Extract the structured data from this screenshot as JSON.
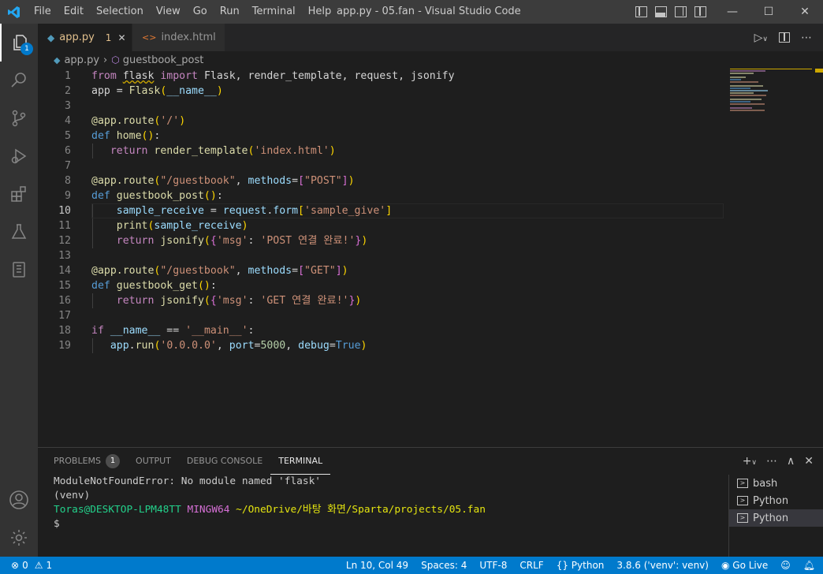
{
  "window": {
    "title": "app.py - 05.fan - Visual Studio Code",
    "menu": [
      "File",
      "Edit",
      "Selection",
      "View",
      "Go",
      "Run",
      "Terminal",
      "Help"
    ]
  },
  "activity_bar": {
    "explorer_badge": "1",
    "items": [
      "explorer-icon",
      "search-icon",
      "source-control-icon",
      "run-debug-icon",
      "extensions-icon",
      "testing-icon",
      "remote-explorer-icon",
      "account-icon",
      "settings-gear-icon"
    ]
  },
  "tabs": [
    {
      "label": "app.py",
      "problems": "1",
      "state": "active"
    },
    {
      "label": "index.html",
      "state": "modified"
    }
  ],
  "breadcrumb": {
    "file": "app.py",
    "symbol": "guestbook_post"
  },
  "editor": {
    "current_line": 10,
    "lines": [
      {
        "n": "1",
        "tokens": [
          [
            "kw2",
            "from "
          ],
          [
            "plain squig",
            "flask"
          ],
          [
            "kw2",
            " import "
          ],
          [
            "plain",
            "Flask, render_template, request, jsonify"
          ]
        ]
      },
      {
        "n": "2",
        "tokens": [
          [
            "plain",
            "app = "
          ],
          [
            "fn",
            "Flask"
          ],
          [
            "br1",
            "("
          ],
          [
            "var",
            "__name__"
          ],
          [
            "br1",
            ")"
          ]
        ]
      },
      {
        "n": "3",
        "tokens": []
      },
      {
        "n": "4",
        "tokens": [
          [
            "fn",
            "@app.route"
          ],
          [
            "br1",
            "("
          ],
          [
            "str",
            "'/'"
          ],
          [
            "br1",
            ")"
          ]
        ]
      },
      {
        "n": "5",
        "tokens": [
          [
            "kw",
            "def "
          ],
          [
            "fn",
            "home"
          ],
          [
            "br1",
            "()"
          ],
          [
            "plain",
            ":"
          ]
        ]
      },
      {
        "n": "6",
        "tokens": [
          [
            "plain",
            "   "
          ],
          [
            "kw2",
            "return "
          ],
          [
            "fn",
            "render_template"
          ],
          [
            "br1",
            "("
          ],
          [
            "str",
            "'index.html'"
          ],
          [
            "br1",
            ")"
          ]
        ]
      },
      {
        "n": "7",
        "tokens": []
      },
      {
        "n": "8",
        "tokens": [
          [
            "fn",
            "@app.route"
          ],
          [
            "br1",
            "("
          ],
          [
            "str",
            "\"/guestbook\""
          ],
          [
            "plain",
            ", "
          ],
          [
            "var",
            "methods"
          ],
          [
            "plain",
            "="
          ],
          [
            "br2",
            "["
          ],
          [
            "str",
            "\"POST\""
          ],
          [
            "br2",
            "]"
          ],
          [
            "br1",
            ")"
          ]
        ]
      },
      {
        "n": "9",
        "tokens": [
          [
            "kw",
            "def "
          ],
          [
            "fn",
            "guestbook_post"
          ],
          [
            "br1",
            "()"
          ],
          [
            "plain",
            ":"
          ]
        ]
      },
      {
        "n": "10",
        "tokens": [
          [
            "plain",
            "    "
          ],
          [
            "var",
            "sample_receive"
          ],
          [
            "plain",
            " = "
          ],
          [
            "var",
            "request"
          ],
          [
            "plain",
            "."
          ],
          [
            "var",
            "form"
          ],
          [
            "br1",
            "["
          ],
          [
            "str",
            "'sample_give'"
          ],
          [
            "br1",
            "]"
          ]
        ]
      },
      {
        "n": "11",
        "tokens": [
          [
            "plain",
            "    "
          ],
          [
            "fn",
            "print"
          ],
          [
            "br1",
            "("
          ],
          [
            "var",
            "sample_receive"
          ],
          [
            "br1",
            ")"
          ]
        ]
      },
      {
        "n": "12",
        "tokens": [
          [
            "plain",
            "    "
          ],
          [
            "kw2",
            "return "
          ],
          [
            "fn",
            "jsonify"
          ],
          [
            "br1",
            "("
          ],
          [
            "br2",
            "{"
          ],
          [
            "str",
            "'msg'"
          ],
          [
            "plain",
            ": "
          ],
          [
            "str",
            "'POST 연결 완료!'"
          ],
          [
            "br2",
            "}"
          ],
          [
            "br1",
            ")"
          ]
        ]
      },
      {
        "n": "13",
        "tokens": []
      },
      {
        "n": "14",
        "tokens": [
          [
            "fn",
            "@app.route"
          ],
          [
            "br1",
            "("
          ],
          [
            "str",
            "\"/guestbook\""
          ],
          [
            "plain",
            ", "
          ],
          [
            "var",
            "methods"
          ],
          [
            "plain",
            "="
          ],
          [
            "br2",
            "["
          ],
          [
            "str",
            "\"GET\""
          ],
          [
            "br2",
            "]"
          ],
          [
            "br1",
            ")"
          ]
        ]
      },
      {
        "n": "15",
        "tokens": [
          [
            "kw",
            "def "
          ],
          [
            "fn",
            "guestbook_get"
          ],
          [
            "br1",
            "()"
          ],
          [
            "plain",
            ":"
          ]
        ]
      },
      {
        "n": "16",
        "tokens": [
          [
            "plain",
            "    "
          ],
          [
            "kw2",
            "return "
          ],
          [
            "fn",
            "jsonify"
          ],
          [
            "br1",
            "("
          ],
          [
            "br2",
            "{"
          ],
          [
            "str",
            "'msg'"
          ],
          [
            "plain",
            ": "
          ],
          [
            "str",
            "'GET 연결 완료!'"
          ],
          [
            "br2",
            "}"
          ],
          [
            "br1",
            ")"
          ]
        ]
      },
      {
        "n": "17",
        "tokens": []
      },
      {
        "n": "18",
        "tokens": [
          [
            "kw2",
            "if "
          ],
          [
            "var",
            "__name__"
          ],
          [
            "plain",
            " == "
          ],
          [
            "str",
            "'__main__'"
          ],
          [
            "plain",
            ":"
          ]
        ]
      },
      {
        "n": "19",
        "tokens": [
          [
            "plain",
            "   "
          ],
          [
            "var",
            "app"
          ],
          [
            "plain",
            "."
          ],
          [
            "fn",
            "run"
          ],
          [
            "br1",
            "("
          ],
          [
            "str",
            "'0.0.0.0'"
          ],
          [
            "plain",
            ", "
          ],
          [
            "var",
            "port"
          ],
          [
            "plain",
            "="
          ],
          [
            "num",
            "5000"
          ],
          [
            "plain",
            ", "
          ],
          [
            "var",
            "debug"
          ],
          [
            "plain",
            "="
          ],
          [
            "kw",
            "True"
          ],
          [
            "br1",
            ")"
          ]
        ]
      }
    ]
  },
  "panel": {
    "tabs": [
      {
        "label": "PROBLEMS",
        "badge": "1"
      },
      {
        "label": "OUTPUT"
      },
      {
        "label": "DEBUG CONSOLE"
      },
      {
        "label": "TERMINAL",
        "active": true
      }
    ],
    "terminal_lines": [
      "ModuleNotFoundError: No module named 'flask'",
      "(venv)"
    ],
    "prompt": {
      "user": "Toras@DESKTOP-LPM48TT",
      "shell": "MINGW64",
      "path": "~/OneDrive/바탕 화면/Sparta/projects/05.fan",
      "symbol": "$"
    },
    "terminals": [
      {
        "label": "bash"
      },
      {
        "label": "Python"
      },
      {
        "label": "Python",
        "selected": true
      }
    ]
  },
  "status": {
    "errors": "0",
    "warnings": "1",
    "position": "Ln 10, Col 49",
    "spaces": "Spaces: 4",
    "encoding": "UTF-8",
    "eol": "CRLF",
    "language": "Python",
    "interpreter": "3.8.6 ('venv': venv)",
    "live": "Go Live"
  }
}
